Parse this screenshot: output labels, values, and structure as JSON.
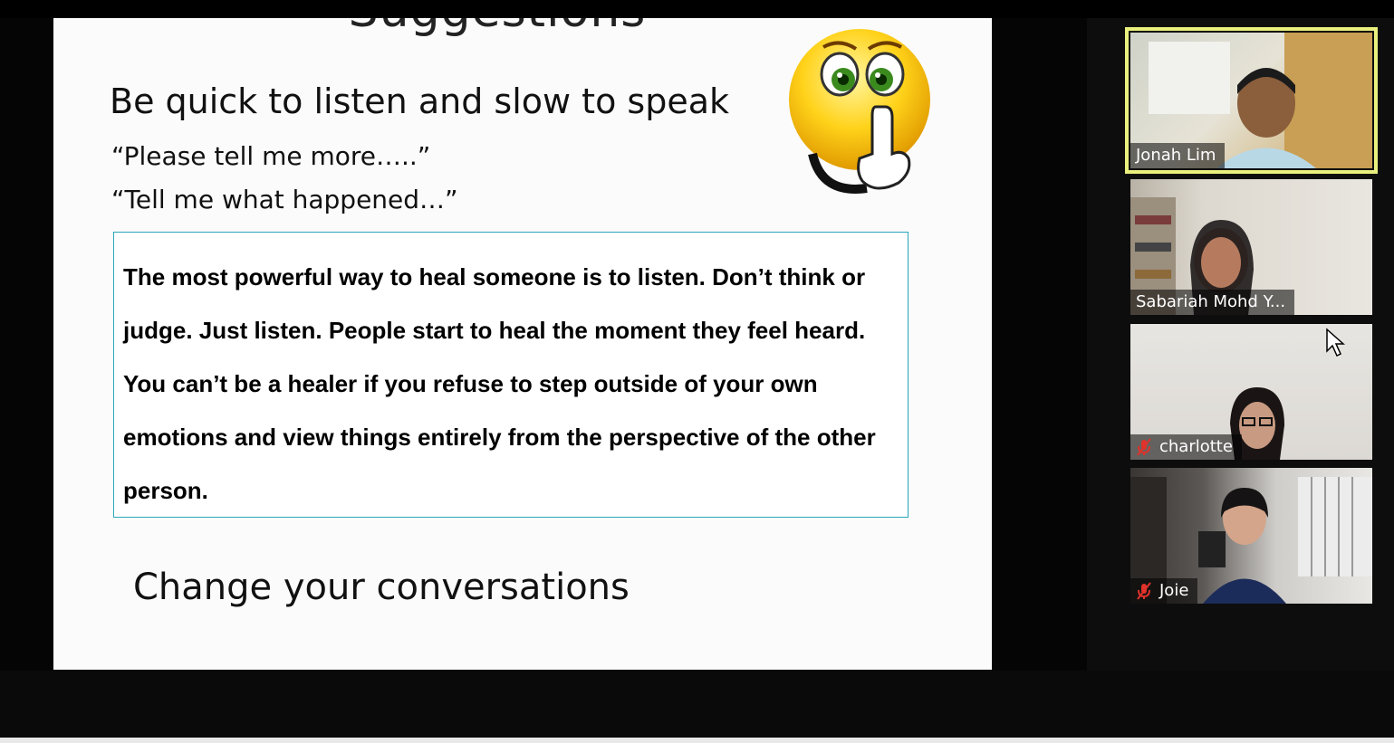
{
  "slide": {
    "title": "Suggestions",
    "heading": "Be quick to listen and slow to speak",
    "quotes": [
      "“Please tell me more…..”",
      "“Tell me what happened…”"
    ],
    "box_text": "The most powerful way to heal someone is to listen. Don’t think or judge. Just listen. People start to heal the moment they feel heard. You can’t be a healer if you refuse to step outside of your own emotions and view things entirely from the perspective of the other person.",
    "footer": "Change your conversations",
    "image_icon": "shush-emoji-icon"
  },
  "participants": [
    {
      "name": "Jonah Lim",
      "muted": false,
      "active_speaker": true
    },
    {
      "name": "Sabariah Mohd Y...",
      "muted": false,
      "active_speaker": false
    },
    {
      "name": "charlotte",
      "muted": true,
      "active_speaker": false
    },
    {
      "name": "Joie",
      "muted": true,
      "active_speaker": false
    }
  ],
  "colors": {
    "active_speaker_border": "#e9f07e",
    "quote_box_border": "#2aa6b8",
    "mute_icon": "#e0322b"
  }
}
